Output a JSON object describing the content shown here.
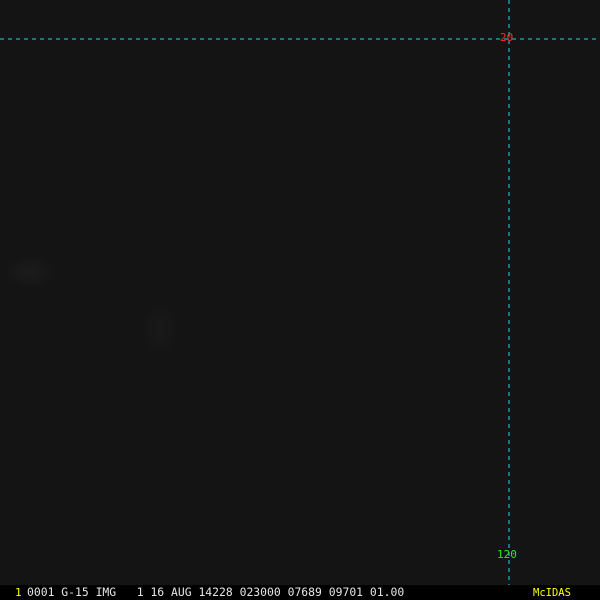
{
  "colors": {
    "background": "#141414",
    "gridline": "#00e5e5",
    "lat_label": "#ff2a2a",
    "lon_label": "#22ee22",
    "frame_number": "#ffff00",
    "info_text": "#e6e6e6",
    "brand": "#ffff00"
  },
  "grid": {
    "latitude_label": "20",
    "longitude_label": "120"
  },
  "info_bar": {
    "frame_number": "1",
    "text": "0001 G-15 IMG   1 16 AUG 14228 023000 07689 09701 01.00",
    "brand": "McIDAS"
  }
}
